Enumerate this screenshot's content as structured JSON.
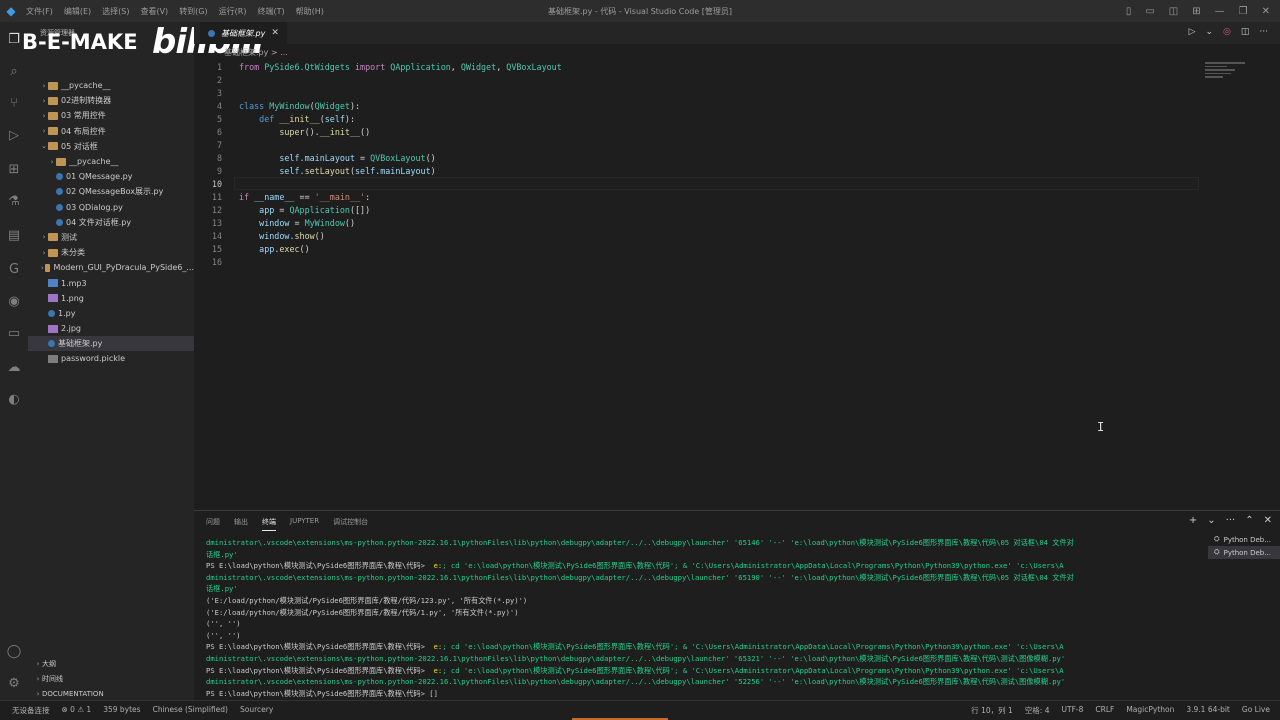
{
  "window": {
    "title": "基础框架.py - 代码 - Visual Studio Code [管理员]",
    "menu": [
      "文件(F)",
      "编辑(E)",
      "选择(S)",
      "查看(V)",
      "转到(G)",
      "运行(R)",
      "终端(T)",
      "帮助(H)"
    ]
  },
  "brand": {
    "name": "B-E-MAKE",
    "site": "bilibili"
  },
  "sidebar": {
    "title": "资源管理器",
    "tree": [
      {
        "label": "__pycache__",
        "kind": "folder",
        "depth": 1
      },
      {
        "label": "02进制转换器",
        "kind": "folder",
        "depth": 1
      },
      {
        "label": "03 常用控件",
        "kind": "folder",
        "depth": 1
      },
      {
        "label": "04 布局控件",
        "kind": "folder",
        "depth": 1
      },
      {
        "label": "05 对话框",
        "kind": "folder-open",
        "depth": 1
      },
      {
        "label": "__pycache__",
        "kind": "folder",
        "depth": 2
      },
      {
        "label": "01 QMessage.py",
        "kind": "py",
        "depth": 2
      },
      {
        "label": "02 QMessageBox展示.py",
        "kind": "py",
        "depth": 2
      },
      {
        "label": "03 QDialog.py",
        "kind": "py",
        "depth": 2
      },
      {
        "label": "04 文件对话框.py",
        "kind": "py",
        "depth": 2
      },
      {
        "label": "测试",
        "kind": "folder",
        "depth": 1
      },
      {
        "label": "未分类",
        "kind": "folder",
        "depth": 1
      },
      {
        "label": "Modern_GUI_PyDracula_PySide6_...",
        "kind": "folder",
        "depth": 1
      },
      {
        "label": "1.mp3",
        "kind": "mp3",
        "depth": 1
      },
      {
        "label": "1.png",
        "kind": "img",
        "depth": 1
      },
      {
        "label": "1.py",
        "kind": "py",
        "depth": 1
      },
      {
        "label": "2.jpg",
        "kind": "img",
        "depth": 1
      },
      {
        "label": "基础框架.py",
        "kind": "py",
        "depth": 1,
        "selected": true
      },
      {
        "label": "password.pickle",
        "kind": "gen",
        "depth": 1
      }
    ],
    "bottom": [
      "大纲",
      "时间线",
      "DOCUMENTATION"
    ]
  },
  "editor": {
    "tab_label": "基础框架.py",
    "breadcrumb": "基础框架.py > ...",
    "current_line": 10,
    "lines": [
      {
        "n": "1",
        "code": [
          [
            "kw",
            "from "
          ],
          [
            "cls",
            "PySide6.QtWidgets"
          ],
          [
            "kw",
            " import "
          ],
          [
            "cls",
            "QApplication"
          ],
          [
            "op",
            ", "
          ],
          [
            "cls",
            "QWidget"
          ],
          [
            "op",
            ", "
          ],
          [
            "cls",
            "QVBoxLayout"
          ]
        ]
      },
      {
        "n": "2",
        "code": []
      },
      {
        "n": "3",
        "code": []
      },
      {
        "n": "4",
        "code": [
          [
            "kb",
            "class "
          ],
          [
            "cls",
            "MyWindow"
          ],
          [
            "op",
            "("
          ],
          [
            "cls",
            "QWidget"
          ],
          [
            "op",
            "):"
          ]
        ]
      },
      {
        "n": "5",
        "code": [
          [
            "op",
            "    "
          ],
          [
            "kb",
            "def "
          ],
          [
            "fn",
            "__init__"
          ],
          [
            "op",
            "("
          ],
          [
            "sf",
            "self"
          ],
          [
            "op",
            "):"
          ]
        ]
      },
      {
        "n": "6",
        "code": [
          [
            "op",
            "        "
          ],
          [
            "fn",
            "super"
          ],
          [
            "op",
            "()."
          ],
          [
            "fn",
            "__init__"
          ],
          [
            "op",
            "()"
          ]
        ]
      },
      {
        "n": "7",
        "code": []
      },
      {
        "n": "8",
        "code": [
          [
            "op",
            "        "
          ],
          [
            "sf",
            "self"
          ],
          [
            "op",
            "."
          ],
          [
            "vr",
            "mainLayout"
          ],
          [
            "op",
            " = "
          ],
          [
            "cls",
            "QVBoxLayout"
          ],
          [
            "op",
            "()"
          ]
        ]
      },
      {
        "n": "9",
        "code": [
          [
            "op",
            "        "
          ],
          [
            "sf",
            "self"
          ],
          [
            "op",
            "."
          ],
          [
            "fn",
            "setLayout"
          ],
          [
            "op",
            "("
          ],
          [
            "sf",
            "self"
          ],
          [
            "op",
            "."
          ],
          [
            "vr",
            "mainLayout"
          ],
          [
            "op",
            ")"
          ]
        ]
      },
      {
        "n": "10",
        "code": []
      },
      {
        "n": "11",
        "code": [
          [
            "kw",
            "if "
          ],
          [
            "vr",
            "__name__"
          ],
          [
            "op",
            " == "
          ],
          [
            "st",
            "'__main__'"
          ],
          [
            "op",
            ":"
          ]
        ]
      },
      {
        "n": "12",
        "code": [
          [
            "op",
            "    "
          ],
          [
            "vr",
            "app"
          ],
          [
            "op",
            " = "
          ],
          [
            "cls",
            "QApplication"
          ],
          [
            "op",
            "([])"
          ]
        ]
      },
      {
        "n": "13",
        "code": [
          [
            "op",
            "    "
          ],
          [
            "vr",
            "window"
          ],
          [
            "op",
            " = "
          ],
          [
            "cls",
            "MyWindow"
          ],
          [
            "op",
            "()"
          ]
        ]
      },
      {
        "n": "14",
        "code": [
          [
            "op",
            "    "
          ],
          [
            "vr",
            "window"
          ],
          [
            "op",
            "."
          ],
          [
            "fn",
            "show"
          ],
          [
            "op",
            "()"
          ]
        ]
      },
      {
        "n": "15",
        "code": [
          [
            "op",
            "    "
          ],
          [
            "vr",
            "app"
          ],
          [
            "op",
            "."
          ],
          [
            "fn",
            "exec"
          ],
          [
            "op",
            "()"
          ]
        ]
      },
      {
        "n": "16",
        "code": []
      }
    ]
  },
  "panel": {
    "tabs": [
      "问题",
      "输出",
      "终端",
      "JUPYTER",
      "调试控制台"
    ],
    "active_tab": "终端",
    "terminals": [
      "Python Deb...",
      "Python Deb..."
    ],
    "lines": [
      [
        [
          "arg",
          "dministrator\\.vscode\\extensions\\ms-python.python-2022.16.1\\pythonFiles\\lib\\python\\debugpy\\adapter/../..\\debugpy\\launcher' '65146' '--' 'e:\\load\\python\\模块测试\\PySide6图形界面库\\教程\\代码\\05 对话框\\04 文件对"
        ]
      ],
      [
        [
          "arg",
          "话框.py'"
        ]
      ],
      [
        [
          "ps",
          "PS E:\\load\\python\\模块测试\\PySide6图形界面库\\教程\\代码> "
        ],
        [
          "cmd",
          " e:"
        ],
        [
          "arg",
          "; cd 'e:\\load\\python\\模块测试\\PySide6图形界面库\\教程\\代码'; & 'C:\\Users\\Administrator\\AppData\\Local\\Programs\\Python\\Python39\\python.exe' 'c:\\Users\\A"
        ]
      ],
      [
        [
          "arg",
          "dministrator\\.vscode\\extensions\\ms-python.python-2022.16.1\\pythonFiles\\lib\\python\\debugpy\\adapter/../..\\debugpy\\launcher' '65190' '--' 'e:\\load\\python\\模块测试\\PySide6图形界面库\\教程\\代码\\05 对话框\\04 文件对"
        ]
      ],
      [
        [
          "arg",
          "话框.py'"
        ]
      ],
      [
        [
          "ps",
          "('E:/load/python/模块测试/PySide6图形界面库/教程/代码/123.py', '所有文件(*.py)')"
        ]
      ],
      [
        [
          "ps",
          "('E:/load/python/模块测试/PySide6图形界面库/教程/代码/1.py', '所有文件(*.py)')"
        ]
      ],
      [
        [
          "ps",
          "('', '')"
        ]
      ],
      [
        [
          "ps",
          "('', '')"
        ]
      ],
      [
        [
          "ps",
          "PS E:\\load\\python\\模块测试\\PySide6图形界面库\\教程\\代码> "
        ],
        [
          "cmd",
          " e:"
        ],
        [
          "arg",
          "; cd 'e:\\load\\python\\模块测试\\PySide6图形界面库\\教程\\代码'; & 'C:\\Users\\Administrator\\AppData\\Local\\Programs\\Python\\Python39\\python.exe' 'c:\\Users\\A"
        ]
      ],
      [
        [
          "arg",
          "dministrator\\.vscode\\extensions\\ms-python.python-2022.16.1\\pythonFiles\\lib\\python\\debugpy\\adapter/../..\\debugpy\\launcher' '65321' '--' 'e:\\load\\python\\模块测试\\PySide6图形界面库\\教程\\代码\\测试\\图像模糊.py'"
        ]
      ],
      [
        [
          "ps",
          "PS E:\\load\\python\\模块测试\\PySide6图形界面库\\教程\\代码> "
        ],
        [
          "cmd",
          " e:"
        ],
        [
          "arg",
          "; cd 'e:\\load\\python\\模块测试\\PySide6图形界面库\\教程\\代码'; & 'C:\\Users\\Administrator\\AppData\\Local\\Programs\\Python\\Python39\\python.exe' 'c:\\Users\\A"
        ]
      ],
      [
        [
          "arg",
          "dministrator\\.vscode\\extensions\\ms-python.python-2022.16.1\\pythonFiles\\lib\\python\\debugpy\\adapter/../..\\debugpy\\launcher' '52256' '--' 'e:\\load\\python\\模块测试\\PySide6图形界面库\\教程\\代码\\测试\\图像模糊.py'"
        ]
      ],
      [
        [
          "ps",
          "PS E:\\load\\python\\模块测试\\PySide6图形界面库\\教程\\代码> []"
        ]
      ]
    ]
  },
  "status": {
    "left": [
      "无设备连接",
      "⊗ 0 ⚠ 1",
      "359 bytes",
      "Chinese (Simplified)",
      "Sourcery"
    ],
    "right": [
      "行 10，列 1",
      "空格: 4",
      "UTF-8",
      "CRLF",
      "MagicPython",
      "3.9.1 64-bit",
      "Go Live"
    ]
  },
  "colors": {
    "accent_progress": "#c66b2c",
    "background": "#1e1e1e",
    "sidebar": "#252526"
  },
  "icons": [
    "files-icon",
    "search-icon",
    "source-control-icon",
    "run-debug-icon",
    "extensions-icon",
    "flask-icon",
    "book-icon",
    "g-icon",
    "globe-icon",
    "folder-icon",
    "docker-icon",
    "edge-icon",
    "account-icon",
    "settings-gear-icon"
  ]
}
